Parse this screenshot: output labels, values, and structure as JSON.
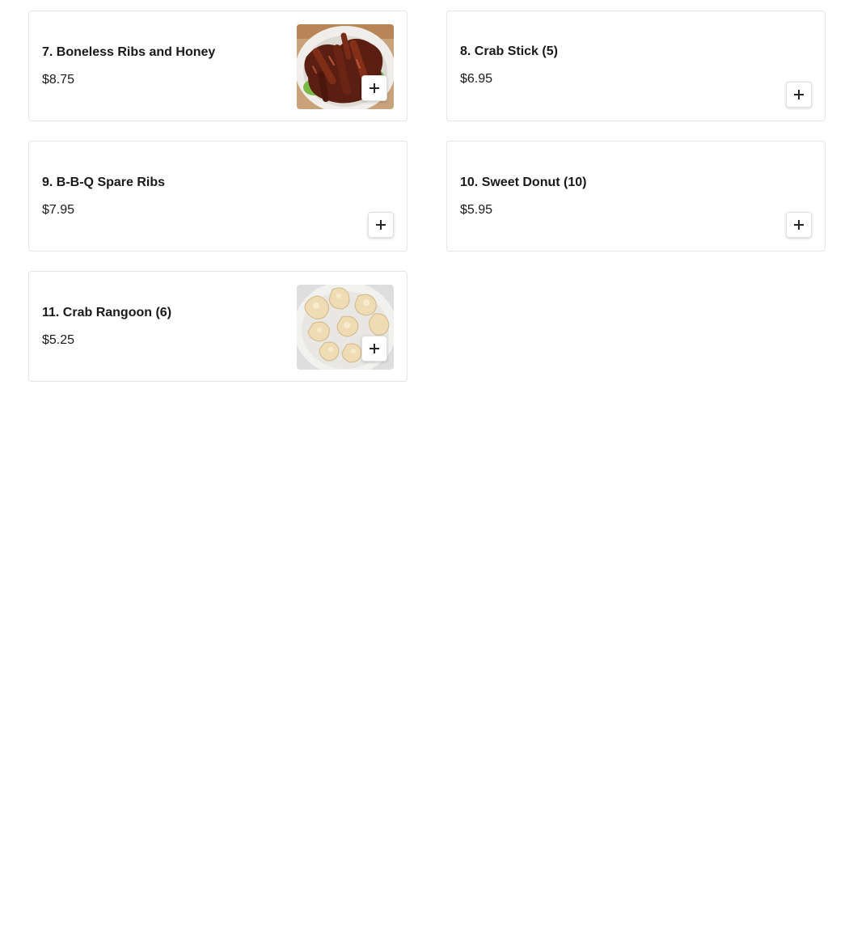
{
  "menu": {
    "items": [
      {
        "name": "7. Boneless Ribs and Honey",
        "price": "$8.75",
        "image": "boneless-ribs-photo"
      },
      {
        "name": "8. Crab Stick (5)",
        "price": "$6.95"
      },
      {
        "name": "9. B-B-Q Spare Ribs",
        "price": "$7.95"
      },
      {
        "name": "10. Sweet Donut (10)",
        "price": "$5.95"
      },
      {
        "name": "11. Crab Rangoon (6)",
        "price": "$5.25",
        "image": "crab-rangoon-photo"
      }
    ],
    "add_icon": "plus-icon"
  }
}
